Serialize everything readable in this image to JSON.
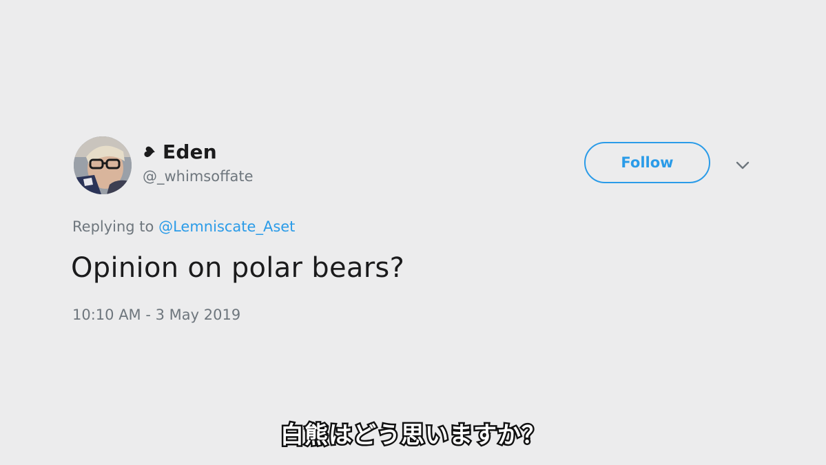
{
  "tweet": {
    "user": {
      "display_name": "Eden",
      "name_icon": "black-heart-icon",
      "handle": "@_whimsoffate",
      "avatar": "user-avatar-photo"
    },
    "follow_label": "Follow",
    "menu_icon": "chevron-down-icon",
    "replying_to_prefix": "Replying to",
    "replying_to_handle": "@Lemniscate_Aset",
    "text": "Opinion on polar bears?",
    "timestamp": "10:10 AM - 3 May 2019"
  },
  "subtitle": {
    "text": "白熊はどう思いますか？"
  },
  "colors": {
    "background": "#ececed",
    "accent": "#2a9be8",
    "text_primary": "#1b1b1c",
    "text_secondary": "#6e767d"
  }
}
